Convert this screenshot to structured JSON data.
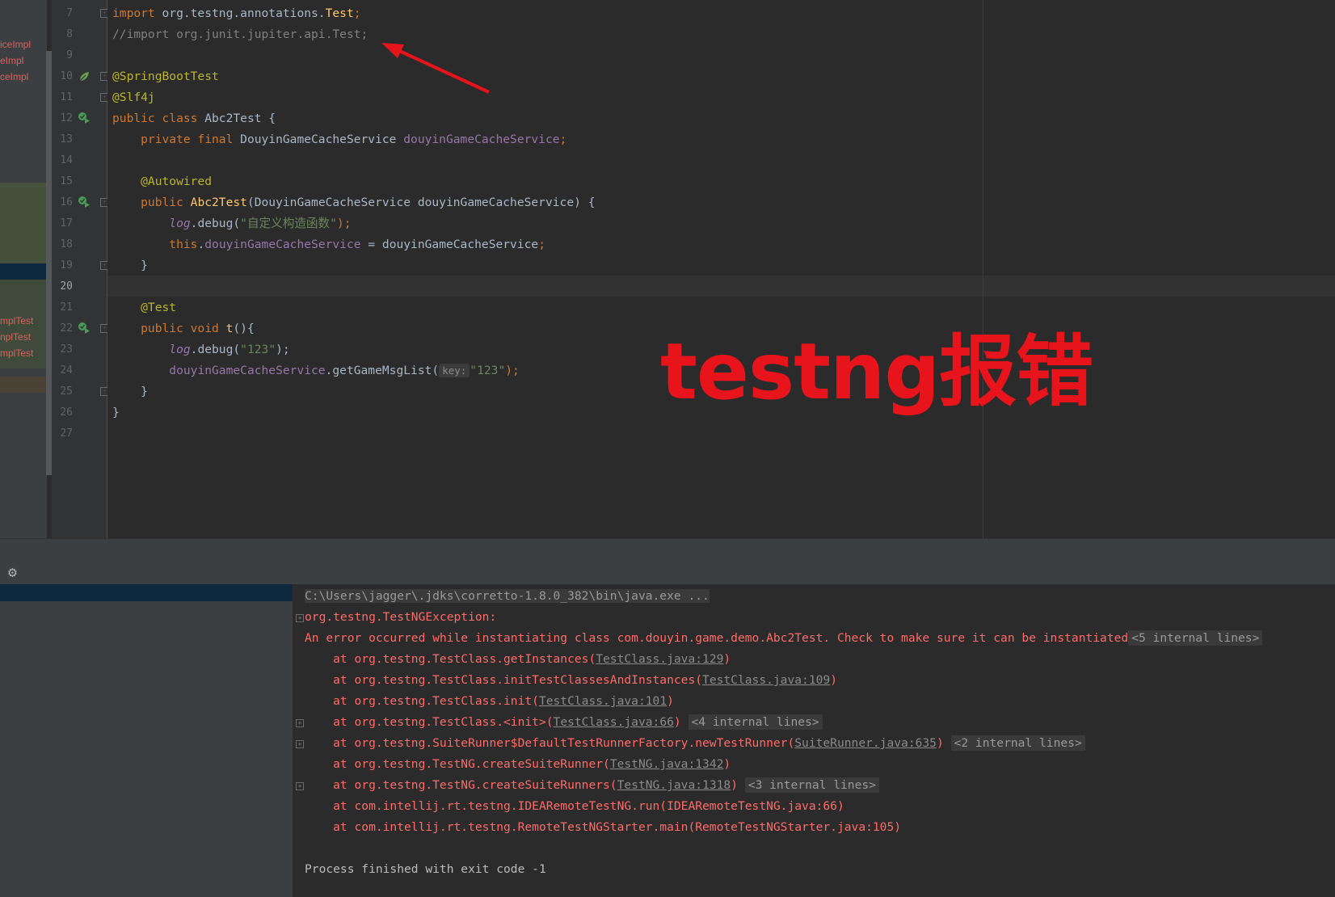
{
  "project_tree": {
    "items_top": [
      "iceImpl",
      "eImpl",
      "ceImpl"
    ],
    "items_bottom": [
      "mplTest",
      "nplTest",
      "mplTest"
    ]
  },
  "editor": {
    "line_numbers": [
      "7",
      "8",
      "9",
      "10",
      "11",
      "12",
      "13",
      "14",
      "15",
      "16",
      "17",
      "18",
      "19",
      "20",
      "21",
      "22",
      "23",
      "24",
      "25",
      "26",
      "27"
    ],
    "current_line": "20",
    "code": {
      "l7_kw": "import",
      "l7_pkg": " org.testng.annotations.",
      "l7_cls": "Test",
      "l7_semi": ";",
      "l8": "//import org.junit.jupiter.api.Test;",
      "l10": "@SpringBootTest",
      "l11": "@Slf4j",
      "l12_kw": "public class",
      "l12_rest": " Abc2Test {",
      "l13_kw": "    private final",
      "l13_type": " DouyinGameCacheService ",
      "l13_field": "douyinGameCacheService",
      "l13_semi": ";",
      "l15": "    @Autowired",
      "l16_kw": "    public",
      "l16_fn": " Abc2Test",
      "l16_rest": "(DouyinGameCacheService douyinGameCacheService) {",
      "l17_log": "log",
      "l17_mid": ".debug(",
      "l17_str": "\"自定义构造函数\"",
      "l17_end": ");",
      "l18_this": "this",
      "l18_dot": ".",
      "l18_field": "douyinGameCacheService",
      "l18_rest": " = douyinGameCacheService",
      "l18_semi": ";",
      "l19": "    }",
      "l21": "    @Test",
      "l22_kw": "    public void",
      "l22_fn": " t",
      "l22_rest": "(){",
      "l23_log": "log",
      "l23_mid": ".debug(",
      "l23_str": "\"123\"",
      "l23_end": ");",
      "l24_field": "douyinGameCacheService",
      "l24_mid": ".getGameMsgList(",
      "l24_hint": "key:",
      "l24_str": "\"123\"",
      "l24_end": ");",
      "l25": "    }",
      "l26": "}"
    }
  },
  "overlay": {
    "text": "testng报错",
    "color": "#e8141b"
  },
  "console": {
    "cmd": "C:\\Users\\jagger\\.jdks\\corretto-1.8.0_382\\bin\\java.exe ...",
    "exception": "org.testng.TestNGException:",
    "error_msg": "An error occurred while instantiating class com.douyin.game.demo.Abc2Test. Check to make sure it can be instantiated",
    "error_fold": "<5 internal lines>",
    "frames": [
      {
        "pre": "    at org.testng.TestClass.getInstances(",
        "link": "TestClass.java:129",
        "post": ")",
        "fold": ""
      },
      {
        "pre": "    at org.testng.TestClass.initTestClassesAndInstances(",
        "link": "TestClass.java:109",
        "post": ")",
        "fold": ""
      },
      {
        "pre": "    at org.testng.TestClass.init(",
        "link": "TestClass.java:101",
        "post": ")",
        "fold": ""
      },
      {
        "pre": "    at org.testng.TestClass.<init>(",
        "link": "TestClass.java:66",
        "post": ")",
        "fold": "<4 internal lines>"
      },
      {
        "pre": "    at org.testng.SuiteRunner$DefaultTestRunnerFactory.newTestRunner(",
        "link": "SuiteRunner.java:635",
        "post": ")",
        "fold": "<2 internal lines>"
      },
      {
        "pre": "    at org.testng.TestNG.createSuiteRunner(",
        "link": "TestNG.java:1342",
        "post": ")",
        "fold": ""
      },
      {
        "pre": "    at org.testng.TestNG.createSuiteRunners(",
        "link": "TestNG.java:1318",
        "post": ")",
        "fold": "<3 internal lines>"
      },
      {
        "pre": "    at com.intellij.rt.testng.IDEARemoteTestNG.run(IDEARemoteTestNG.java:66)",
        "link": "",
        "post": "",
        "fold": ""
      },
      {
        "pre": "    at com.intellij.rt.testng.RemoteTestNGStarter.main(RemoteTestNGStarter.java:105)",
        "link": "",
        "post": "",
        "fold": ""
      }
    ],
    "finished": "Process finished with exit code -1"
  }
}
